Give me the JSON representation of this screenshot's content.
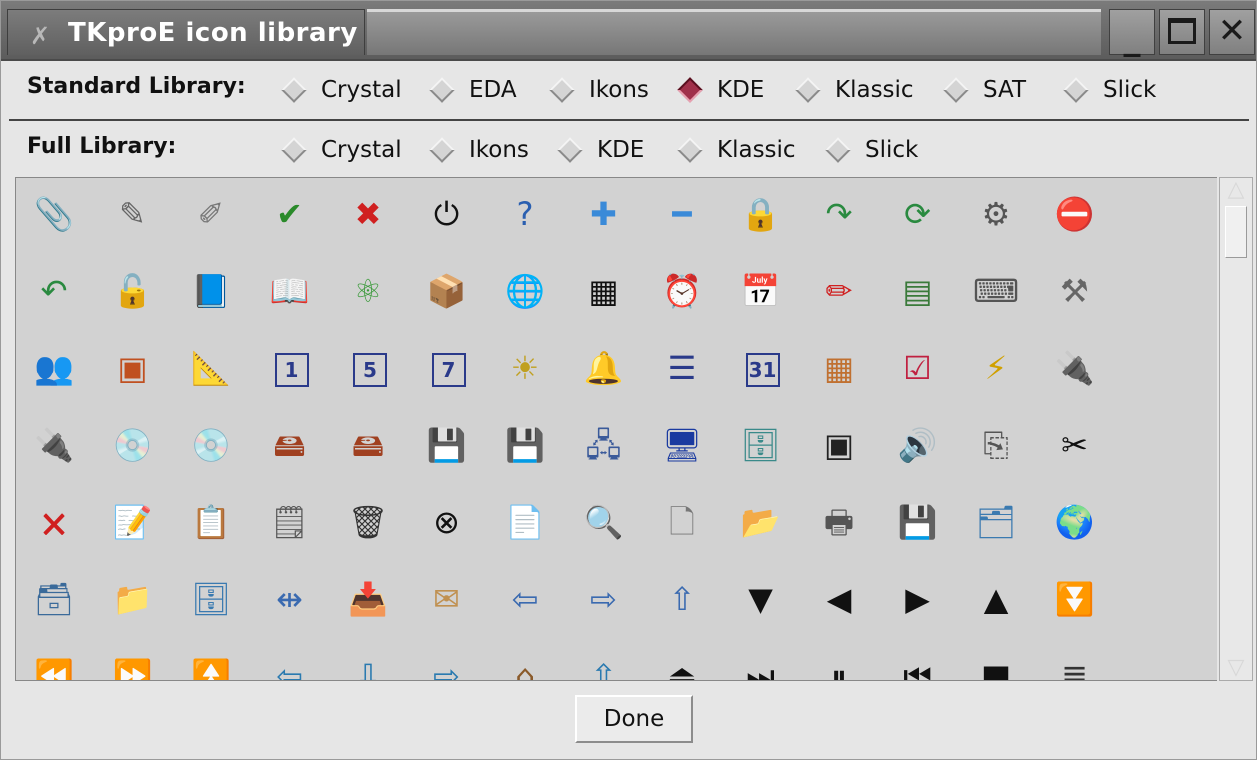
{
  "window": {
    "title": "TKproE icon library",
    "title_icon": "x-brush-icon",
    "buttons": {
      "minimize": "_",
      "close": "✕"
    }
  },
  "standard_library": {
    "label": "Standard Library:",
    "options": [
      "Crystal",
      "EDA",
      "Ikons",
      "KDE",
      "Klassic",
      "SAT",
      "Slick"
    ],
    "selected": "KDE"
  },
  "full_library": {
    "label": "Full Library:",
    "options": [
      "Crystal",
      "Ikons",
      "KDE",
      "Klassic",
      "Slick"
    ],
    "selected": null
  },
  "icons": [
    [
      "paperclip-icon",
      "📎",
      "#555"
    ],
    [
      "pencil-gray-icon",
      "✎",
      "#666"
    ],
    [
      "pencil-sparkle-icon",
      "✐",
      "#777"
    ],
    [
      "check-icon",
      "✔",
      "#2a8a2a"
    ],
    [
      "x-icon",
      "✖",
      "#d02020"
    ],
    [
      "power-icon",
      "⏻",
      "#111"
    ],
    [
      "help-icon",
      "?",
      "#2a5fb0"
    ],
    [
      "plus-icon",
      "✚",
      "#3a8ad8"
    ],
    [
      "minus-icon",
      "━",
      "#3a8ad8"
    ],
    [
      "lock-icon",
      "🔒",
      "#a08040"
    ],
    [
      "redo-icon",
      "↷",
      "#2a8a40"
    ],
    [
      "reload-icon",
      "⟳",
      "#2a8a40"
    ],
    [
      "gear-icon",
      "⚙",
      "#555"
    ],
    [
      "stop-icon",
      "⛔",
      "#c03030"
    ],
    [
      "undo-icon",
      "↶",
      "#2a8a40"
    ],
    [
      "unlock-icon",
      "🔓",
      "#a08040"
    ],
    [
      "book-closed-icon",
      "📘",
      "#2a6a5a"
    ],
    [
      "book-open-icon",
      "📖",
      "#a08040"
    ],
    [
      "molecule-icon",
      "⚛",
      "#3a9a3a"
    ],
    [
      "package-icon",
      "📦",
      "#c0a040"
    ],
    [
      "globe-icon",
      "🌐",
      "#2a6ab0"
    ],
    [
      "calculator-icon",
      "▦",
      "#111"
    ],
    [
      "clock-icon",
      "⏰",
      "#9a1a1a"
    ],
    [
      "date-icon",
      "📅",
      "#c07030"
    ],
    [
      "red-pen-icon",
      "✏",
      "#d02020"
    ],
    [
      "spreadsheet-icon",
      "▤",
      "#3a7a3a"
    ],
    [
      "wrench-keyboard-icon",
      "⌨",
      "#555"
    ],
    [
      "hammer-icon",
      "⚒",
      "#666"
    ],
    [
      "users-icon",
      "👥",
      "#3a6aa0"
    ],
    [
      "presentation-icon",
      "▣",
      "#c05020"
    ],
    [
      "ruler-pen-icon",
      "📐",
      "#a08040"
    ],
    [
      "calendar-1-icon",
      "1",
      "#2a3a8a"
    ],
    [
      "calendar-5-icon",
      "5",
      "#2a3a8a"
    ],
    [
      "calendar-7-icon",
      "7",
      "#2a3a8a"
    ],
    [
      "calendar-sun-icon",
      "☀",
      "#c0a020"
    ],
    [
      "bell-icon",
      "🔔",
      "#c09020"
    ],
    [
      "list-icon",
      "☰",
      "#2a3a8a"
    ],
    [
      "calendar-31-icon",
      "31",
      "#2a3a8a"
    ],
    [
      "calendar-grid-icon",
      "▦",
      "#c07030"
    ],
    [
      "calendar-check-icon",
      "☑",
      "#c02040"
    ],
    [
      "plug-spark-icon",
      "⚡",
      "#d0a000"
    ],
    [
      "plug-icon",
      "🔌",
      "#555"
    ],
    [
      "plug-unplugged-icon",
      "🔌",
      "#333"
    ],
    [
      "cdrom-green-icon",
      "💿",
      "#3a8a3a"
    ],
    [
      "cdrom-icon",
      "💿",
      "#777"
    ],
    [
      "harddrive-green-icon",
      "🖴",
      "#a04020"
    ],
    [
      "harddrive-icon",
      "🖴",
      "#a04020"
    ],
    [
      "floppy-green-icon",
      "💾",
      "#555"
    ],
    [
      "floppy-icon",
      "💾",
      "#777"
    ],
    [
      "network-icon",
      "🖧",
      "#3a5a9a"
    ],
    [
      "computer-icon",
      "🖥",
      "#1a3aa0"
    ],
    [
      "network-drive-icon",
      "🗄",
      "#3a8a8a"
    ],
    [
      "monitor-icon",
      "▣",
      "#222"
    ],
    [
      "speaker-icon",
      "🔊",
      "#3a8a9a"
    ],
    [
      "copy-icon",
      "⎘",
      "#555"
    ],
    [
      "cut-icon",
      "✂",
      "#111"
    ],
    [
      "delete-file-icon",
      "🗙",
      "#d02020"
    ],
    [
      "edit-file-icon",
      "📝",
      "#c06020"
    ],
    [
      "paste-icon",
      "📋",
      "#666"
    ],
    [
      "shredder-icon",
      "🗒",
      "#555"
    ],
    [
      "trash-icon",
      "🗑",
      "#333"
    ],
    [
      "cancel-icon",
      "⊗",
      "#111"
    ],
    [
      "document-icon",
      "📄",
      "#777"
    ],
    [
      "find-icon",
      "🔍",
      "#3a7a8a"
    ],
    [
      "new-file-icon",
      "🗋",
      "#777"
    ],
    [
      "folder-open-icon",
      "📂",
      "#a07030"
    ],
    [
      "printer-icon",
      "🖶",
      "#555"
    ],
    [
      "save-as-icon",
      "💾",
      "#555"
    ],
    [
      "folder-blue-icon",
      "🗂",
      "#3a7ab0"
    ],
    [
      "folder-globe-icon",
      "🌍",
      "#3a7ab0"
    ],
    [
      "folder-lock-icon",
      "🗃",
      "#3a6a9a"
    ],
    [
      "folder-new-icon",
      "📁",
      "#c0a040"
    ],
    [
      "folder-drawer-icon",
      "🗄",
      "#3a7ab0"
    ],
    [
      "frame-arrows-icon",
      "⇹",
      "#3a6ab0"
    ],
    [
      "inbox-download-icon",
      "📥",
      "#3a6a9a"
    ],
    [
      "mail-icon",
      "✉",
      "#c09050"
    ],
    [
      "file-export-icon",
      "⇦",
      "#3a6ab0"
    ],
    [
      "file-import-icon",
      "⇨",
      "#3a6ab0"
    ],
    [
      "file-up-icon",
      "⇧",
      "#3a6ab0"
    ],
    [
      "triangle-down-icon",
      "▼",
      "#111"
    ],
    [
      "triangle-left-icon",
      "◀",
      "#111"
    ],
    [
      "triangle-right-icon",
      "▶",
      "#111"
    ],
    [
      "triangle-up-icon",
      "▲",
      "#111"
    ],
    [
      "double-down-icon",
      "⏬",
      "#111"
    ],
    [
      "rewind-icon",
      "⏪",
      "#111"
    ],
    [
      "fast-forward-icon",
      "⏩",
      "#111"
    ],
    [
      "double-up-icon",
      "⏫",
      "#111"
    ],
    [
      "arrow-left-icon",
      "⇦",
      "#2a7ab0"
    ],
    [
      "arrow-down-icon",
      "⇩",
      "#2a7ab0"
    ],
    [
      "arrow-right-icon",
      "⇨",
      "#2a7ab0"
    ],
    [
      "home-icon",
      "⌂",
      "#8a5a2a"
    ],
    [
      "arrow-up-icon",
      "⇧",
      "#2a7ab0"
    ],
    [
      "eject-icon",
      "⏏",
      "#111"
    ],
    [
      "skip-end-icon",
      "⏭",
      "#111"
    ],
    [
      "pause-icon",
      "⏸",
      "#111"
    ],
    [
      "skip-start-icon",
      "⏮",
      "#111"
    ],
    [
      "stop-square-icon",
      "■",
      "#111"
    ],
    [
      "align-justify-icon",
      "≣",
      "#333"
    ]
  ],
  "footer": {
    "done_label": "Done"
  }
}
